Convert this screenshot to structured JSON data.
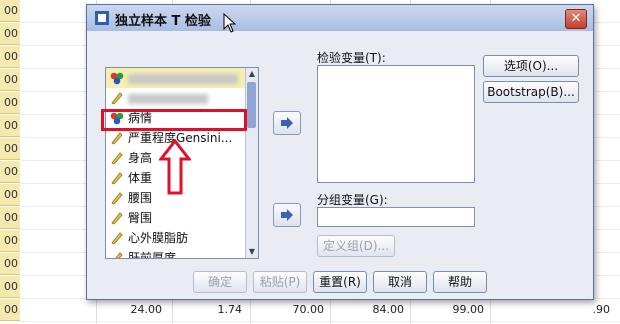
{
  "spreadsheet": {
    "row_labels": [
      "00",
      "00",
      "00",
      "00",
      "00",
      "00",
      "00",
      "00",
      "00",
      "00",
      "00",
      "00",
      "00",
      "00"
    ],
    "bottom_row": [
      "24.00",
      "1.74",
      "70.00",
      "84.00",
      "99.00",
      ".90"
    ]
  },
  "dialog": {
    "title": "独立样本 T 检验",
    "close_glyph": "✕",
    "source_variables": [
      {
        "label": "",
        "icon": "nominal-icon",
        "blurred": true
      },
      {
        "label": "",
        "icon": "scale-icon",
        "blurred": true
      },
      {
        "label": "病情",
        "icon": "nominal-icon",
        "blurred": false
      },
      {
        "label": "严重程度Gensini...",
        "icon": "scale-icon",
        "blurred": false
      },
      {
        "label": "身高",
        "icon": "scale-icon",
        "blurred": false
      },
      {
        "label": "体重",
        "icon": "scale-icon",
        "blurred": false
      },
      {
        "label": "腰围",
        "icon": "scale-icon",
        "blurred": false
      },
      {
        "label": "臀围",
        "icon": "scale-icon",
        "blurred": false
      },
      {
        "label": "心外膜脂肪",
        "icon": "scale-icon",
        "blurred": false
      },
      {
        "label": "肝前厚度",
        "icon": "scale-icon",
        "blurred": false
      }
    ],
    "test_variables_label": "检验变量(T):",
    "grouping_variable_label": "分组变量(G):",
    "define_groups_label": "定义组(D)...",
    "options_label": "选项(O)...",
    "bootstrap_label": "Bootstrap(B)...",
    "ok_label": "确定",
    "paste_label": "粘贴(P)",
    "reset_label": "重置(R)",
    "cancel_label": "取消",
    "help_label": "帮助"
  },
  "colors": {
    "highlight": "#e0102a",
    "title_bar": "#a9bde4"
  }
}
